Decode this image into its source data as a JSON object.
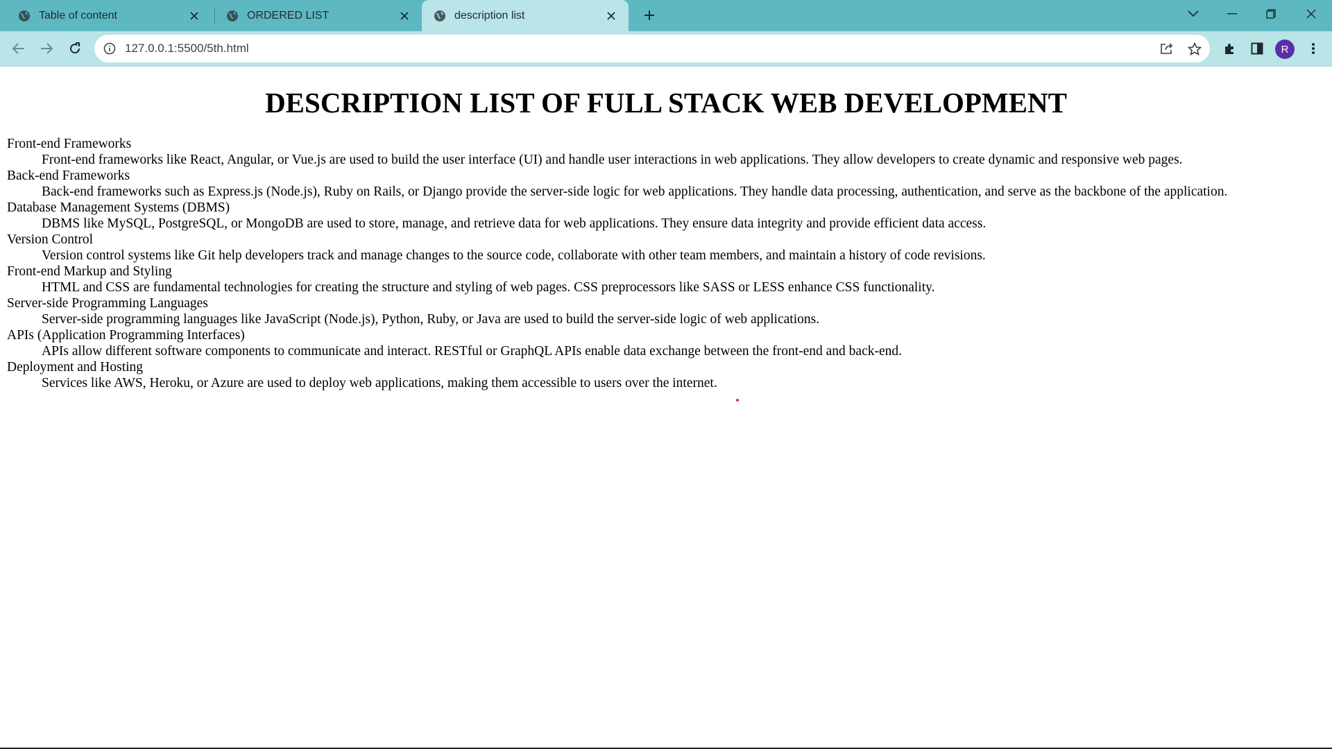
{
  "browser": {
    "tabs": [
      {
        "title": "Table of content",
        "active": false
      },
      {
        "title": "ORDERED LIST",
        "active": false
      },
      {
        "title": "description list",
        "active": true
      }
    ],
    "url": "127.0.0.1:5500/5th.html",
    "profile_initial": "R",
    "colors": {
      "tabstrip": "#5db8c2",
      "active_tab": "#b9e4e8",
      "avatar": "#5a2ea6"
    }
  },
  "page": {
    "title": "DESCRIPTION LIST OF FULL STACK WEB DEVELOPMENT",
    "items": [
      {
        "term": "Front-end Frameworks",
        "desc": "Front-end frameworks like React, Angular, or Vue.js are used to build the user interface (UI) and handle user interactions in web applications. They allow developers to create dynamic and responsive web pages."
      },
      {
        "term": "Back-end Frameworks",
        "desc": "Back-end frameworks such as Express.js (Node.js), Ruby on Rails, or Django provide the server-side logic for web applications. They handle data processing, authentication, and serve as the backbone of the application."
      },
      {
        "term": "Database Management Systems (DBMS)",
        "desc": "DBMS like MySQL, PostgreSQL, or MongoDB are used to store, manage, and retrieve data for web applications. They ensure data integrity and provide efficient data access."
      },
      {
        "term": "Version Control",
        "desc": "Version control systems like Git help developers track and manage changes to the source code, collaborate with other team members, and maintain a history of code revisions."
      },
      {
        "term": "Front-end Markup and Styling",
        "desc": "HTML and CSS are fundamental technologies for creating the structure and styling of web pages. CSS preprocessors like SASS or LESS enhance CSS functionality."
      },
      {
        "term": "Server-side Programming Languages",
        "desc": "Server-side programming languages like JavaScript (Node.js), Python, Ruby, or Java are used to build the server-side logic of web applications."
      },
      {
        "term": "APIs (Application Programming Interfaces)",
        "desc": "APIs allow different software components to communicate and interact. RESTful or GraphQL APIs enable data exchange between the front-end and back-end."
      },
      {
        "term": "Deployment and Hosting",
        "desc": "Services like AWS, Heroku, or Azure are used to deploy web applications, making them accessible to users over the internet."
      }
    ]
  }
}
